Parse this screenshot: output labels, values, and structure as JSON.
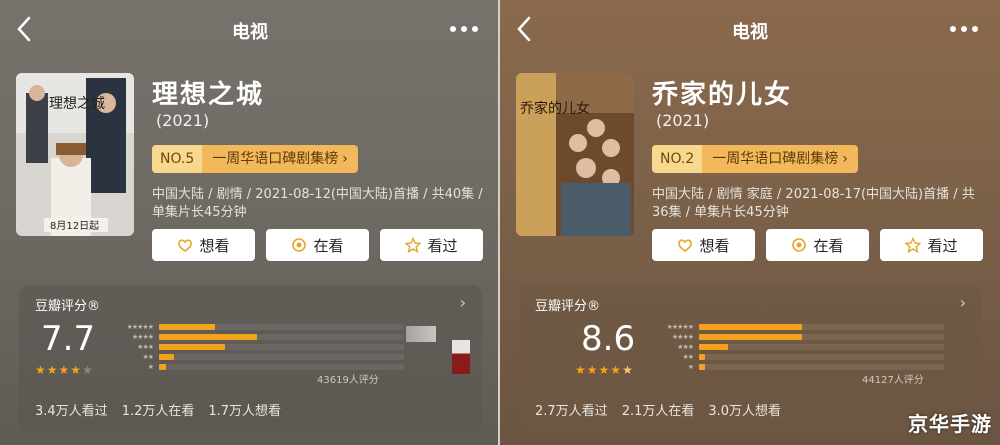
{
  "screens": [
    {
      "header_title": "电视",
      "show_name": "理想之城",
      "year": "(2021)",
      "rank_no": "NO.5",
      "rank_list": "一周华语口碑剧集榜",
      "meta": "中国大陆 / 剧情 / 2021-08-12(中国大陆)首播 / 共40集 / 单集片长45分钟",
      "poster_caption": "8月12日起",
      "poster_title": "理想之城",
      "buttons": {
        "want": "想看",
        "watching": "在看",
        "watched": "看过"
      },
      "rating_label": "豆瓣评分®",
      "score": "7.7",
      "star_fill": 4,
      "distribution": [
        0.23,
        0.4,
        0.27,
        0.06,
        0.03
      ],
      "rating_count": "43619人评分",
      "stats": [
        "3.4万人看过",
        "1.2万人在看",
        "1.7万人想看"
      ]
    },
    {
      "header_title": "电视",
      "show_name": "乔家的儿女",
      "year": "(2021)",
      "rank_no": "NO.2",
      "rank_list": "一周华语口碑剧集榜",
      "meta": "中国大陆 / 剧情 家庭 / 2021-08-17(中国大陆)首播 / 共36集 / 单集片长45分钟",
      "poster_caption": "",
      "poster_title": "乔家的儿女",
      "buttons": {
        "want": "想看",
        "watching": "在看",
        "watched": "看过"
      },
      "rating_label": "豆瓣评分®",
      "score": "8.6",
      "star_fill": 4.5,
      "distribution": [
        0.42,
        0.42,
        0.12,
        0.02,
        0.02
      ],
      "rating_count": "44127人评分",
      "stats": [
        "2.7万人看过",
        "2.1万人在看",
        "3.0万人想看"
      ]
    }
  ],
  "colors": {
    "accent": "#f4a21c",
    "rank_bg": "#f3b85b",
    "rank_no_bg": "#f7d88e"
  },
  "icons": [
    "back-icon",
    "more-icon",
    "heart-plus-icon",
    "target-icon",
    "star-icon",
    "chevron-right-icon"
  ],
  "watermark": "京华手游"
}
